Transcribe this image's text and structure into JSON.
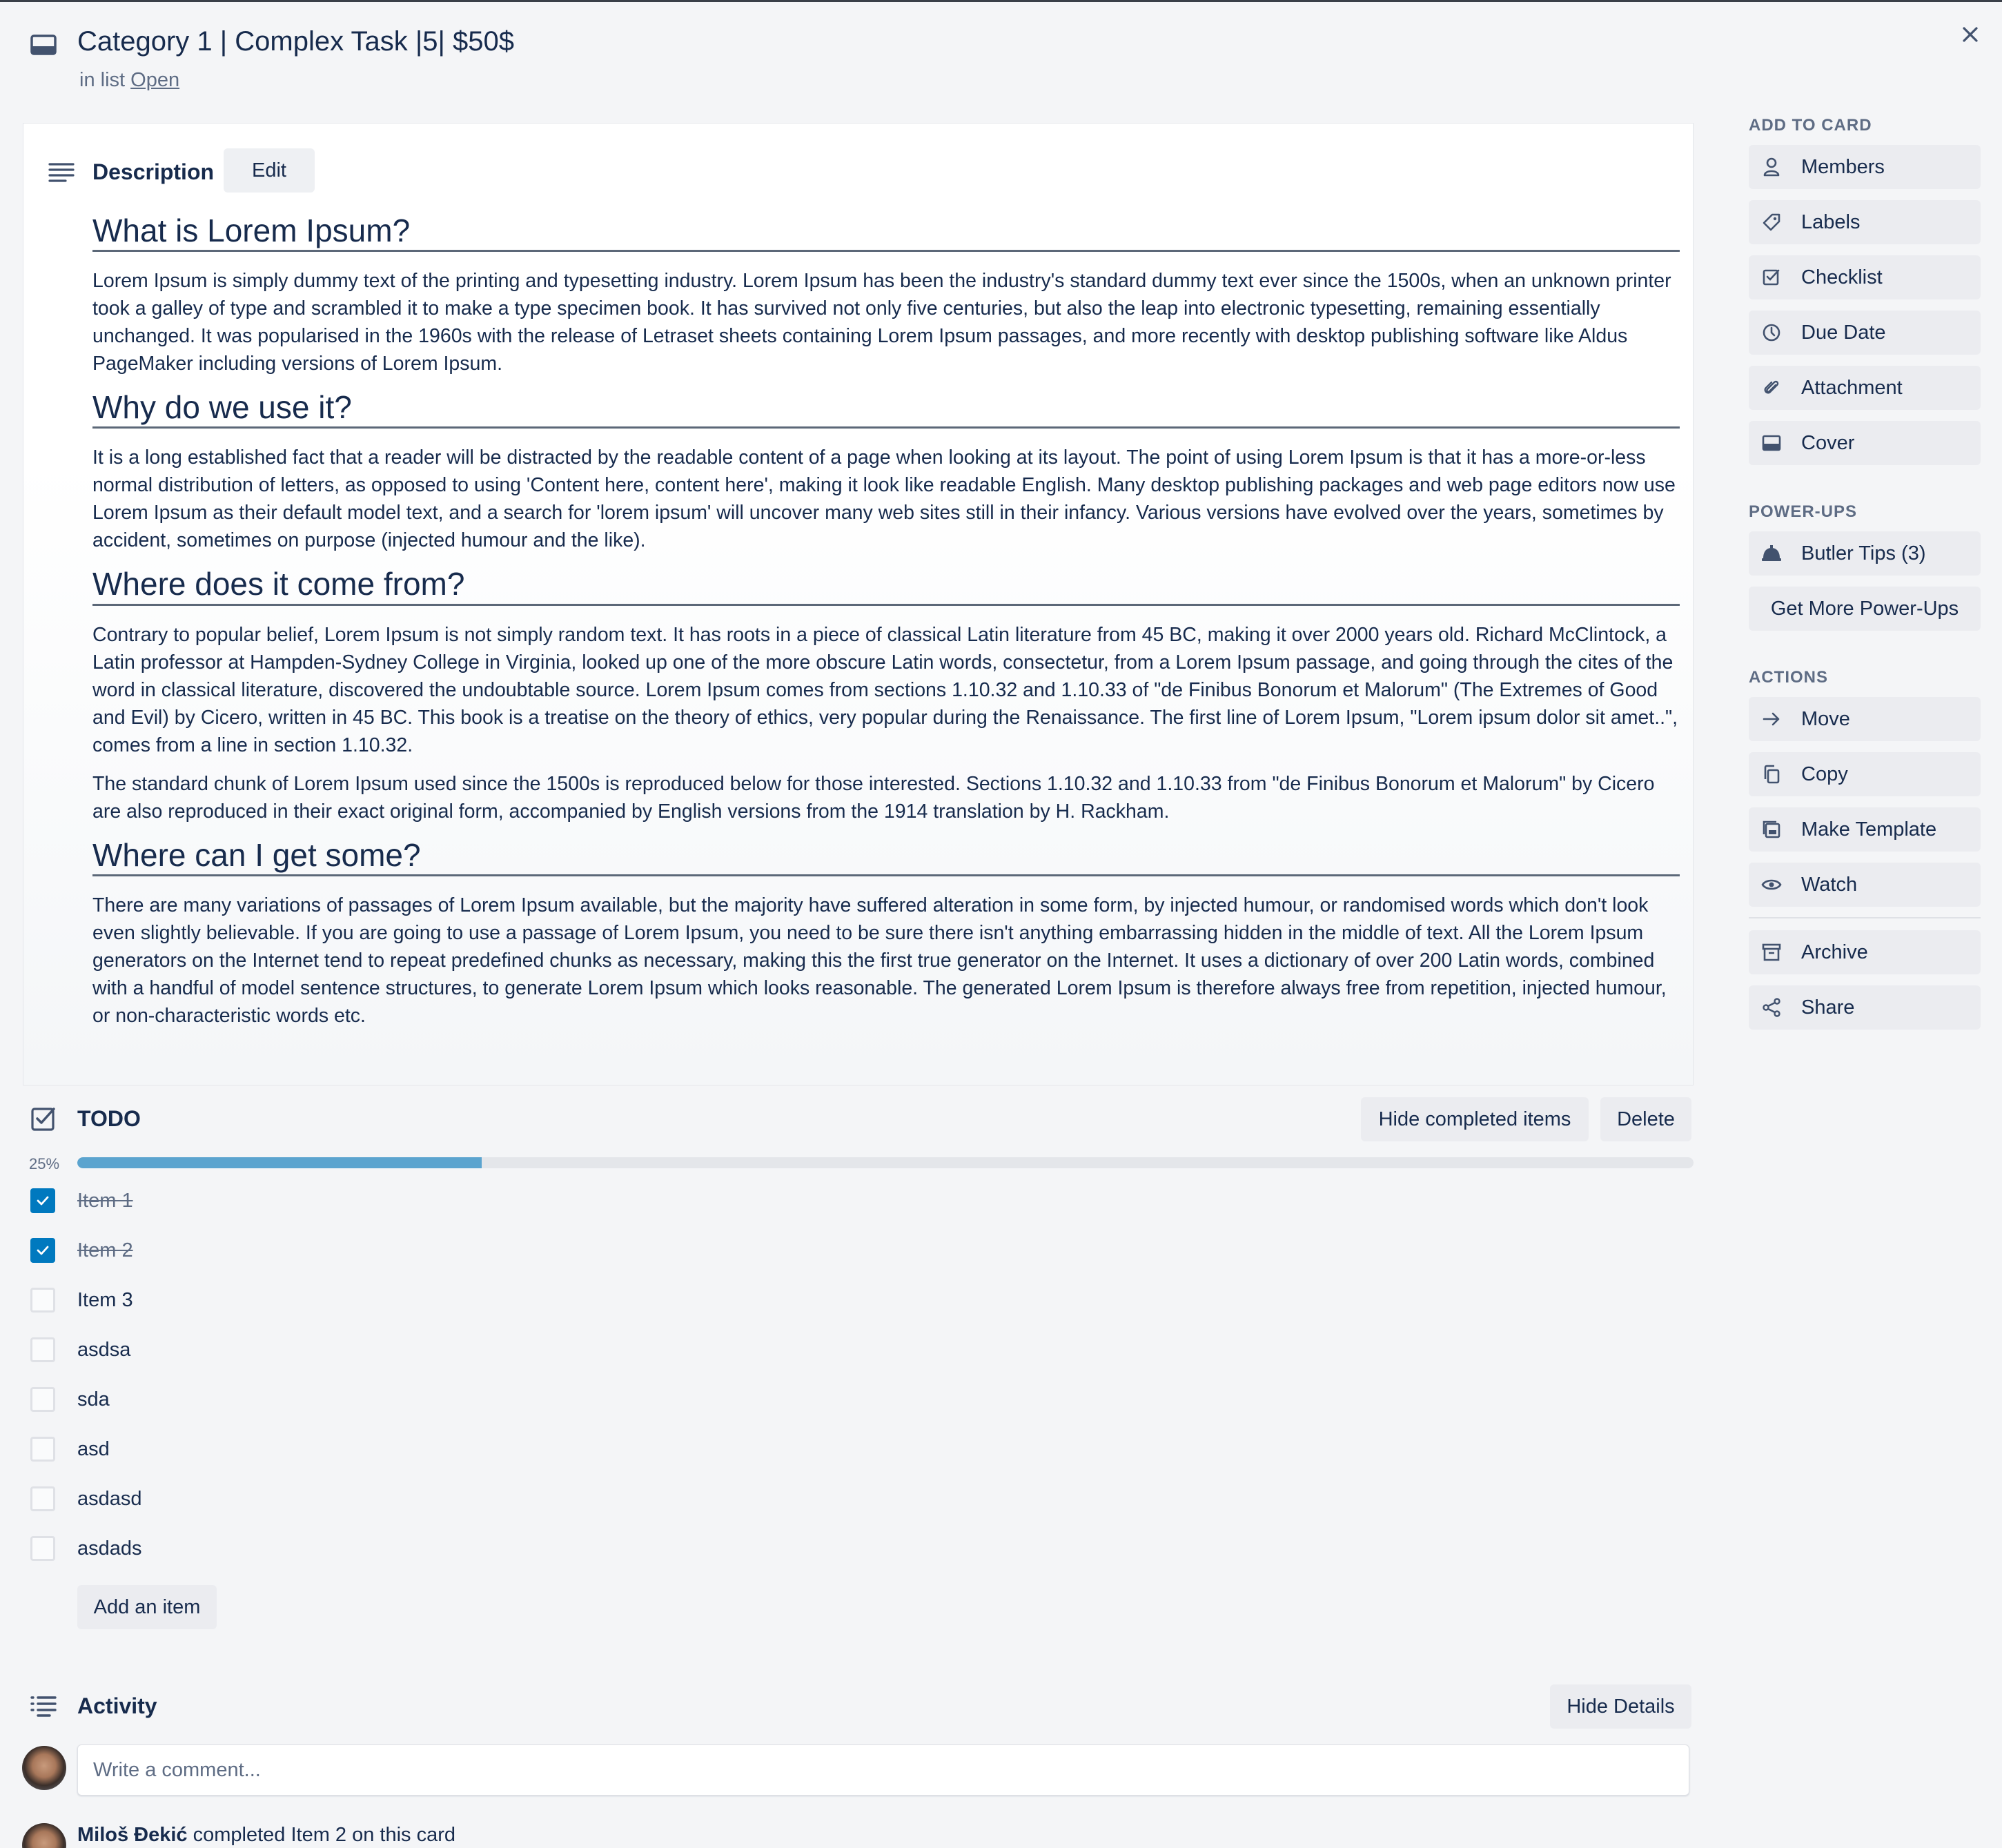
{
  "header": {
    "title": "Category 1 | Complex Task |5| $50$",
    "in_list_prefix": "in list",
    "list_name": "Open"
  },
  "description": {
    "title": "Description",
    "edit_label": "Edit",
    "sections": [
      {
        "heading": "What is Lorem Ipsum?",
        "paragraphs": [
          "Lorem Ipsum is simply dummy text of the printing and typesetting industry. Lorem Ipsum has been the industry's standard dummy text ever since the 1500s, when an unknown printer took a galley of type and scrambled it to make a type specimen book. It has survived not only five centuries, but also the leap into electronic typesetting, remaining essentially unchanged. It was popularised in the 1960s with the release of Letraset sheets containing Lorem Ipsum passages, and more recently with desktop publishing software like Aldus PageMaker including versions of Lorem Ipsum."
        ]
      },
      {
        "heading": "Why do we use it?",
        "paragraphs": [
          "It is a long established fact that a reader will be distracted by the readable content of a page when looking at its layout. The point of using Lorem Ipsum is that it has a more-or-less normal distribution of letters, as opposed to using 'Content here, content here', making it look like readable English. Many desktop publishing packages and web page editors now use Lorem Ipsum as their default model text, and a search for 'lorem ipsum' will uncover many web sites still in their infancy. Various versions have evolved over the years, sometimes by accident, sometimes on purpose (injected humour and the like)."
        ]
      },
      {
        "heading": "Where does it come from?",
        "paragraphs": [
          "Contrary to popular belief, Lorem Ipsum is not simply random text. It has roots in a piece of classical Latin literature from 45 BC, making it over 2000 years old. Richard McClintock, a Latin professor at Hampden-Sydney College in Virginia, looked up one of the more obscure Latin words, consectetur, from a Lorem Ipsum passage, and going through the cites of the word in classical literature, discovered the undoubtable source. Lorem Ipsum comes from sections 1.10.32 and 1.10.33 of \"de Finibus Bonorum et Malorum\" (The Extremes of Good and Evil) by Cicero, written in 45 BC. This book is a treatise on the theory of ethics, very popular during the Renaissance. The first line of Lorem Ipsum, \"Lorem ipsum dolor sit amet..\", comes from a line in section 1.10.32.",
          "The standard chunk of Lorem Ipsum used since the 1500s is reproduced below for those interested. Sections 1.10.32 and 1.10.33 from \"de Finibus Bonorum et Malorum\" by Cicero are also reproduced in their exact original form, accompanied by English versions from the 1914 translation by H. Rackham."
        ]
      },
      {
        "heading": "Where can I get some?",
        "paragraphs": [
          "There are many variations of passages of Lorem Ipsum available, but the majority have suffered alteration in some form, by injected humour, or randomised words which don't look even slightly believable. If you are going to use a passage of Lorem Ipsum, you need to be sure there isn't anything embarrassing hidden in the middle of text. All the Lorem Ipsum generators on the Internet tend to repeat predefined chunks as necessary, making this the first true generator on the Internet. It uses a dictionary of over 200 Latin words, combined with a handful of model sentence structures, to generate Lorem Ipsum which looks reasonable. The generated Lorem Ipsum is therefore always free from repetition, injected humour, or non-characteristic words etc."
        ]
      }
    ]
  },
  "checklist": {
    "title": "TODO",
    "hide_completed_label": "Hide completed items",
    "delete_label": "Delete",
    "progress_text": "25%",
    "progress_value": 0.25,
    "progress_color": "#5ba4cf",
    "items": [
      {
        "label": "Item 1",
        "checked": true
      },
      {
        "label": "Item 2",
        "checked": true
      },
      {
        "label": "Item 3",
        "checked": false
      },
      {
        "label": "asdsa",
        "checked": false
      },
      {
        "label": "sda",
        "checked": false
      },
      {
        "label": "asd",
        "checked": false
      },
      {
        "label": "asdasd",
        "checked": false
      },
      {
        "label": "asdads",
        "checked": false
      }
    ],
    "add_item_label": "Add an item"
  },
  "activity": {
    "title": "Activity",
    "hide_details_label": "Hide Details",
    "comment_placeholder": "Write a comment...",
    "entries": [
      {
        "user": "Miloš Đekić",
        "action": " completed Item 2 on this card"
      }
    ]
  },
  "sidebar": {
    "add_to_card_heading": "ADD TO CARD",
    "add_to_card": [
      {
        "label": "Members",
        "icon": "person-icon"
      },
      {
        "label": "Labels",
        "icon": "tag-icon"
      },
      {
        "label": "Checklist",
        "icon": "checklist-icon"
      },
      {
        "label": "Due Date",
        "icon": "clock-icon"
      },
      {
        "label": "Attachment",
        "icon": "paperclip-icon"
      },
      {
        "label": "Cover",
        "icon": "cover-icon"
      }
    ],
    "power_ups_heading": "POWER-UPS",
    "butler_label": "Butler Tips (3)",
    "get_more_label": "Get More Power-Ups",
    "actions_heading": "ACTIONS",
    "actions": [
      {
        "label": "Move",
        "icon": "arrow-right-icon"
      },
      {
        "label": "Copy",
        "icon": "copy-icon"
      },
      {
        "label": "Make Template",
        "icon": "template-icon"
      },
      {
        "label": "Watch",
        "icon": "eye-icon"
      }
    ],
    "archive_label": "Archive",
    "share_label": "Share"
  },
  "colors": {
    "accent": "#0079bf",
    "text": "#172b4d",
    "muted": "#5e6c84",
    "button_bg": "#ebecf0"
  }
}
